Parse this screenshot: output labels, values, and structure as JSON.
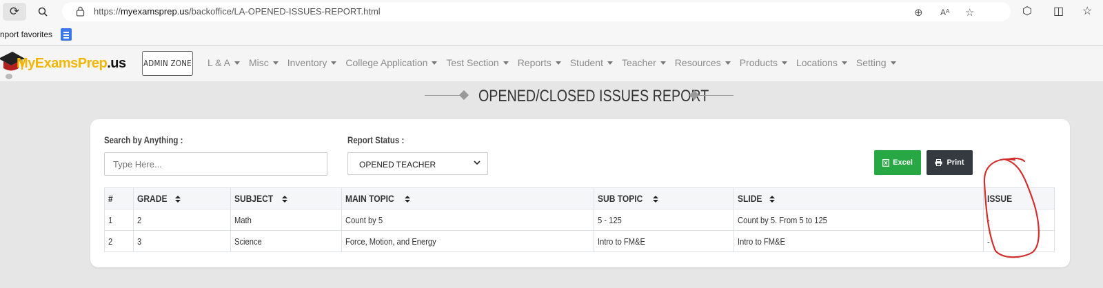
{
  "browser": {
    "url_prefix": "https://",
    "url_host": "myexamsprep.us",
    "url_path": "/backoffice/LA-OPENED-ISSUES-REPORT.html",
    "favorites_label": "nport favorites"
  },
  "site": {
    "logo_main": "MyExamsPrep",
    "logo_suffix": ".us",
    "admin_zone_label": "ADMIN ZONE",
    "nav_items": [
      "L & A",
      "Misc",
      "Inventory",
      "College Application",
      "Test Section",
      "Reports",
      "Student",
      "Teacher",
      "Resources",
      "Products",
      "Locations",
      "Setting"
    ]
  },
  "page": {
    "title": "OPENED/CLOSED ISSUES REPORT"
  },
  "filters": {
    "search_label": "Search by Anything :",
    "search_placeholder": "Type Here...",
    "status_label": "Report Status :",
    "status_value": "OPENED TEACHER"
  },
  "buttons": {
    "excel": "Excel",
    "print": "Print"
  },
  "table": {
    "headers": [
      "#",
      "GRADE",
      "SUBJECT",
      "MAIN TOPIC",
      "SUB TOPIC",
      "SLIDE",
      "ISSUE"
    ],
    "rows": [
      [
        "1",
        "2",
        "Math",
        "Count by 5",
        "5 - 125",
        "Count by 5. From 5 to 125",
        "-"
      ],
      [
        "2",
        "3",
        "Science",
        "Force, Motion, and Energy",
        "Intro to FM&E",
        "Intro to FM&E",
        "-"
      ]
    ]
  },
  "colors": {
    "excel_button": "#28a745",
    "print_button": "#343a40",
    "annotation_circle": "#d32f2f",
    "logo_yellow": "#f2b705"
  }
}
